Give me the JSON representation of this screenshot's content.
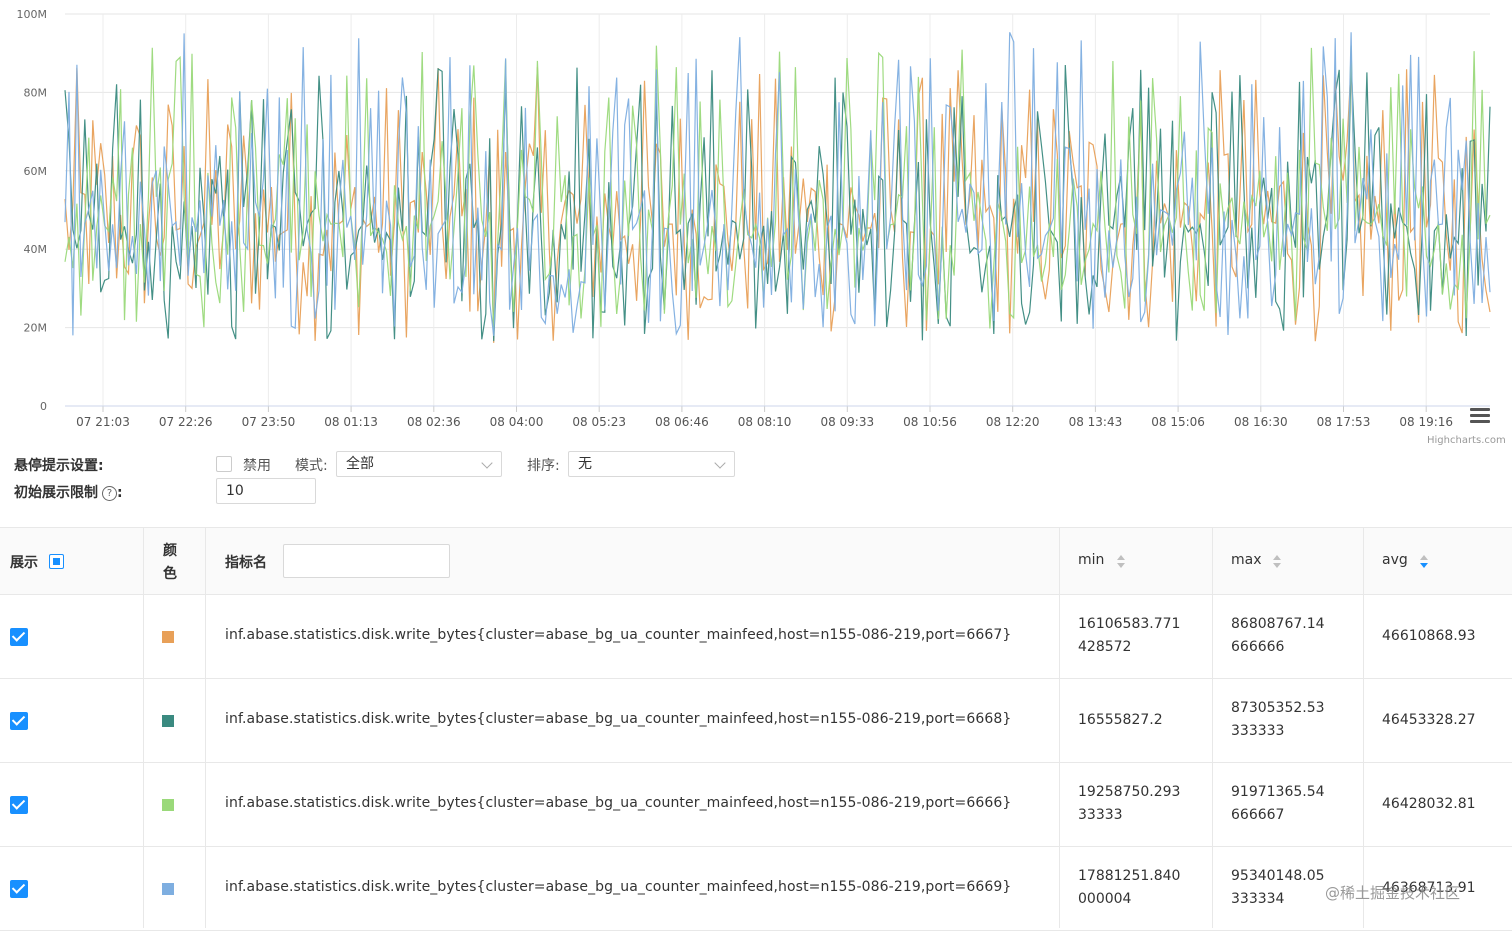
{
  "chart_data": {
    "type": "line",
    "title": "",
    "y_ticks": [
      "100M",
      "80M",
      "60M",
      "40M",
      "20M",
      "0"
    ],
    "ylim": [
      0,
      100000000
    ],
    "x_ticks": [
      "07 21:03",
      "07 22:26",
      "07 23:50",
      "08 01:13",
      "08 02:36",
      "08 04:00",
      "08 05:23",
      "08 06:46",
      "08 08:10",
      "08 09:33",
      "08 10:56",
      "08 12:20",
      "08 13:43",
      "08 15:06",
      "08 16:30",
      "08 17:53",
      "08 19:16"
    ],
    "grid": true,
    "legend": "none",
    "credits": "Highcharts.com",
    "points_per_series": 360,
    "series": [
      {
        "color": "#e8a058",
        "min": 16106583.771428572,
        "max": 86808767.14666666,
        "avg": 46610868.93
      },
      {
        "color": "#3a8a80",
        "min": 16555827.2,
        "max": 87305352.53333333,
        "avg": 46453328.27
      },
      {
        "color": "#9ad97a",
        "min": 19258750.29333333,
        "max": 91971365.54666667,
        "avg": 46428032.81
      },
      {
        "color": "#7eaee0",
        "min": 17881251.840000004,
        "max": 95340148.05333334,
        "avg": 46368713.91
      }
    ]
  },
  "settings": {
    "hover_label": "悬停提示设置:",
    "disable_label": "禁用",
    "mode_label": "模式:",
    "mode_value": "全部",
    "sort_label": "排序:",
    "sort_value": "无",
    "limit_label": "初始展示限制",
    "limit_help": "?",
    "limit_colon": ":",
    "limit_value": "10"
  },
  "table": {
    "col_show": "展示",
    "col_color_1": "颜",
    "col_color_2": "色",
    "col_name": "指标名",
    "col_min": "min",
    "col_max": "max",
    "col_avg": "avg",
    "rows": [
      {
        "color": "#e8a058",
        "name": "inf.abase.statistics.disk.write_bytes{cluster=abase_bg_ua_counter_mainfeed,host=n155-086-219,port=6667}",
        "min_l1": "16106583.771",
        "min_l2": "428572",
        "max_l1": "86808767.14",
        "max_l2": "666666",
        "avg": "46610868.93"
      },
      {
        "color": "#3a8a80",
        "name": "inf.abase.statistics.disk.write_bytes{cluster=abase_bg_ua_counter_mainfeed,host=n155-086-219,port=6668}",
        "min_l1": "16555827.2",
        "min_l2": "",
        "max_l1": "87305352.53",
        "max_l2": "333333",
        "avg": "46453328.27"
      },
      {
        "color": "#9ad97a",
        "name": "inf.abase.statistics.disk.write_bytes{cluster=abase_bg_ua_counter_mainfeed,host=n155-086-219,port=6666}",
        "min_l1": "19258750.293",
        "min_l2": "33333",
        "max_l1": "91971365.54",
        "max_l2": "666667",
        "avg": "46428032.81"
      },
      {
        "color": "#7eaee0",
        "name": "inf.abase.statistics.disk.write_bytes{cluster=abase_bg_ua_counter_mainfeed,host=n155-086-219,port=6669}",
        "min_l1": "17881251.840",
        "min_l2": "000004",
        "max_l1": "95340148.05",
        "max_l2": "333334",
        "avg": "46368713.91"
      }
    ]
  },
  "footer_watermark": "@稀土掘金技术社区"
}
